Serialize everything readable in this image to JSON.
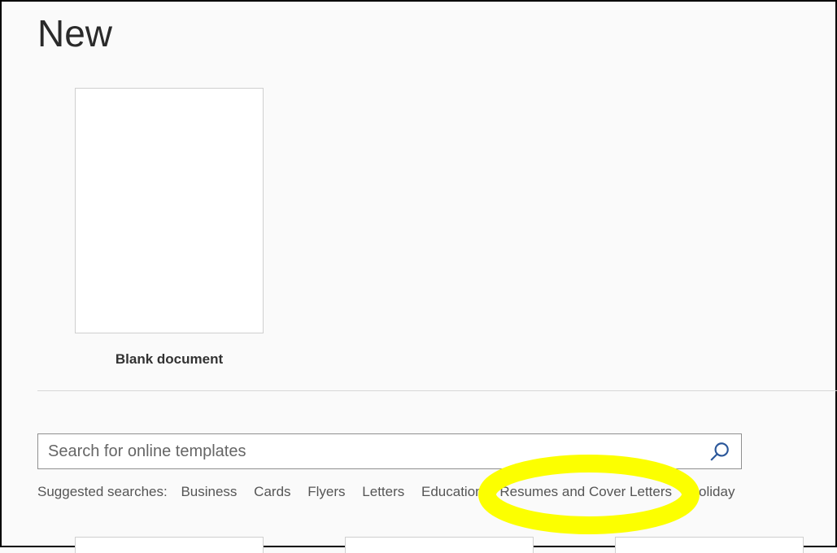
{
  "header": {
    "title": "New"
  },
  "templates": {
    "blank": {
      "label": "Blank document"
    }
  },
  "search": {
    "placeholder": "Search for online templates"
  },
  "suggested": {
    "label": "Suggested searches:",
    "items": [
      "Business",
      "Cards",
      "Flyers",
      "Letters",
      "Education",
      "Resumes and Cover Letters",
      "Holiday"
    ]
  }
}
